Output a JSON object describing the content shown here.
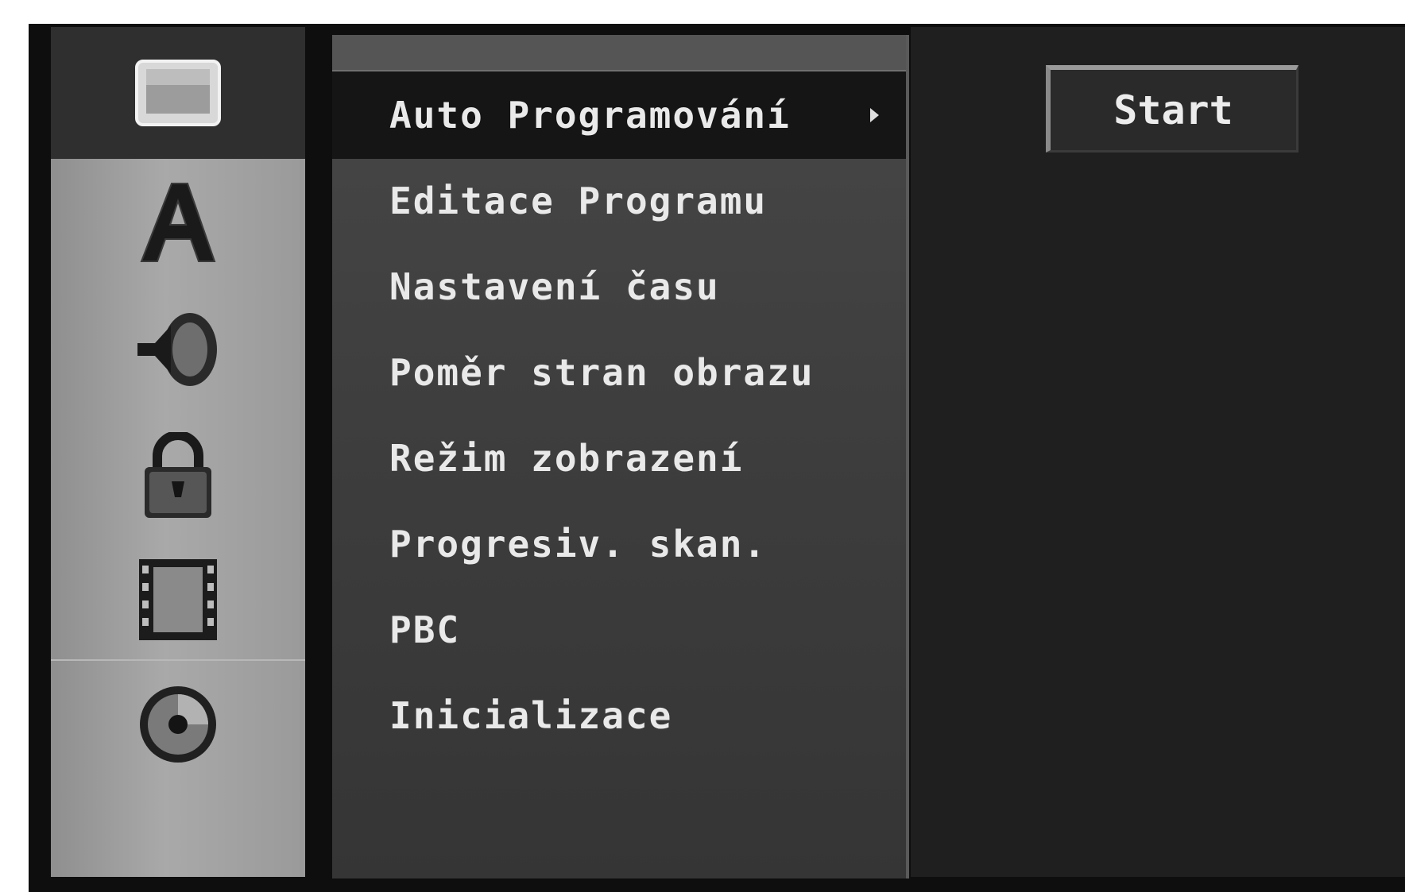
{
  "sidebar": {
    "icons": [
      {
        "name": "tv-screen-icon",
        "active": true
      },
      {
        "name": "language-a-icon",
        "active": false
      },
      {
        "name": "speaker-icon",
        "active": false
      },
      {
        "name": "padlock-icon",
        "active": false
      },
      {
        "name": "film-strip-icon",
        "active": false
      },
      {
        "name": "disc-icon",
        "active": false
      }
    ]
  },
  "menu": {
    "items": [
      {
        "label": "Auto Programování",
        "selected": true
      },
      {
        "label": "Editace Programu",
        "selected": false
      },
      {
        "label": "Nastavení času",
        "selected": false
      },
      {
        "label": "Poměr stran obrazu",
        "selected": false
      },
      {
        "label": "Režim zobrazení",
        "selected": false
      },
      {
        "label": "Progresiv. skan.",
        "selected": false
      },
      {
        "label": "PBC",
        "selected": false
      },
      {
        "label": "Inicializace",
        "selected": false
      }
    ]
  },
  "panel": {
    "start_label": "Start"
  },
  "colors": {
    "osd_background": "#0e0e0e",
    "rail": "#a0a0a0",
    "menu": "#404040",
    "selection": "#151515",
    "text": "#e9e9e9"
  }
}
